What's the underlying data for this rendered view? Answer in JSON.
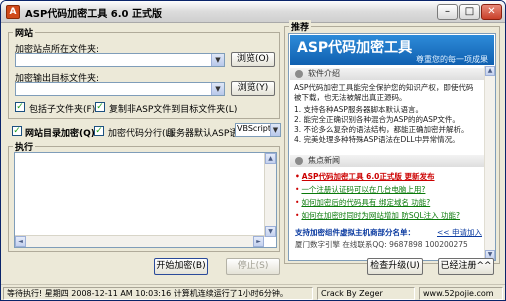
{
  "window": {
    "title": "ASP代码加密工具 6.0 正式版",
    "icon_glyph": "A"
  },
  "site": {
    "group_title": "网站",
    "source_label": "加密站点所在文件夹:",
    "source_value": "",
    "source_browse": "浏览(O)",
    "target_label": "加密输出目标文件夹:",
    "target_value": "",
    "target_browse": "浏览(Y)",
    "include_subfolders": {
      "label": "包括子文件夹(F)",
      "checked": true
    },
    "copy_non_asp": {
      "label": "复制非ASP文件到目标文件夹(L)",
      "checked": true
    }
  },
  "options": {
    "directory_encrypt": {
      "label": "网站目录加密(Q)",
      "checked": true
    },
    "code_split": {
      "label": "加密代码分行(L)",
      "checked": true
    },
    "server_lang_label": "服务器默认ASP语言:",
    "server_lang_value": "VBScript"
  },
  "execute": {
    "group_title": "执行"
  },
  "buttons": {
    "start": "开始加密(B)",
    "stop": "停止(S)",
    "check_update": "检查升级(U)",
    "registered": "已经注册^^"
  },
  "recommend": {
    "group_title": "推荐",
    "banner_title": "ASP代码加密工具",
    "banner_sub": "尊重您的每一项成果",
    "intro_head": "软件介绍",
    "intro_lines": [
      "ASP代码加密工具能完全保护您的知识产权，即使代码",
      "被下载，也无法被解出真正源码。",
      "1. 支持各种ASP服务器脚本默认语言。",
      "2. 能完全正确识别各种混合为ASP的的ASP文件。",
      "3. 不论多么复杂的语法结构，都能正确加密并解析。",
      "4. 完美处理多种特殊ASP语法在DLL中异常情况。"
    ],
    "news_head": "焦点新闻",
    "news": [
      {
        "text": "ASP代码加密工具 6.0正式版 更新发布",
        "highlight": true
      },
      {
        "text": "一个注册认证码可以在几台电脑上用?",
        "highlight": false
      },
      {
        "text": "如何加密后的代码具有 绑定域名 功能?",
        "highlight": false
      },
      {
        "text": "如何在加密时同时为网站增加 防SQL注入 功能?",
        "highlight": false
      }
    ],
    "support_line": "支持加密组件虚拟主机商部分名单：",
    "support_more": "<< 申请加入",
    "contacts": "厦门数字引擎   在线联系QQ: 9687898  100200275"
  },
  "status": {
    "main": "等待执行! 星期四 2008-12-11 AM 10:03:16 计算机连续运行了1小时6分钟。",
    "crack": "Crack By Zeger",
    "site": "www.52pojie.com"
  }
}
